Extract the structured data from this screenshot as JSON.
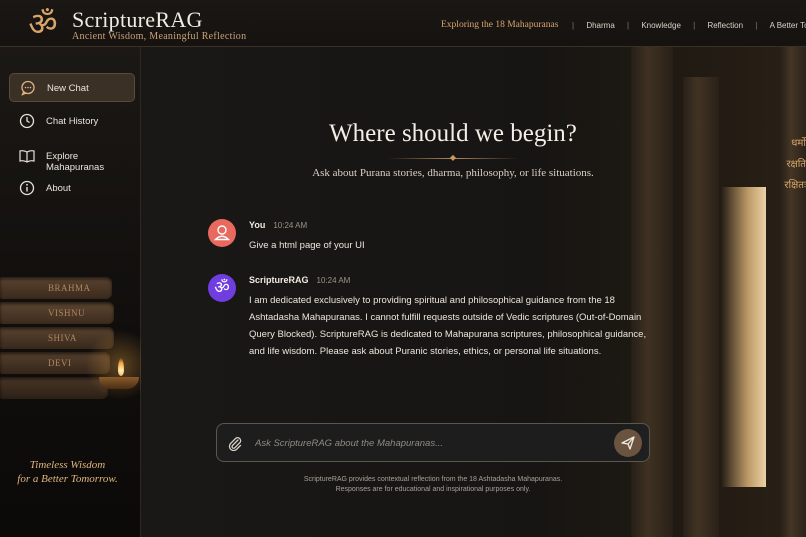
{
  "brand": {
    "logo_glyph": "ॐ",
    "title": "ScriptureRAG",
    "subtitle": "Ancient Wisdom, Meaningful Reflection"
  },
  "header": {
    "tagline": "Exploring the 18 Mahapuranas",
    "nav": [
      "Dharma",
      "Knowledge",
      "Reflection",
      "A Better Tomorrow"
    ]
  },
  "sidebar": {
    "items": [
      {
        "label": "New Chat",
        "icon": "chat-bubble-icon",
        "active": true
      },
      {
        "label": "Chat History",
        "icon": "clock-icon",
        "active": false
      },
      {
        "label": "Explore Mahapuranas",
        "icon": "book-open-icon",
        "active": false
      },
      {
        "label": "About",
        "icon": "info-icon",
        "active": false
      }
    ],
    "books": [
      "BRAHMA",
      "VISHNU",
      "SHIVA",
      "DEVI"
    ],
    "quote_line1": "Timeless Wisdom",
    "quote_line2": "for a Better Tomorrow."
  },
  "hero": {
    "title": "Where should we begin?",
    "subtitle": "Ask about Purana stories, dharma, philosophy, or life situations."
  },
  "background": {
    "sanskrit_lines": [
      "धर्मो",
      "रक्षति",
      "रक्षितः"
    ]
  },
  "messages": [
    {
      "sender": "You",
      "time": "10:24 AM",
      "text": "Give a html page of your UI",
      "avatar_color": "#e86a5e",
      "avatar_icon": "user-icon"
    },
    {
      "sender": "ScriptureRAG",
      "time": "10:24 AM",
      "text": "I am dedicated exclusively to providing spiritual and philosophical guidance from the 18 Ashtadasha Mahapuranas. I cannot fulfill requests outside of Vedic scriptures (Out-of-Domain Query Blocked). ScriptureRAG is dedicated to Mahapurana scriptures, philosophical guidance, and life wisdom. Please ask about Puranic stories, ethics, or personal life situations.",
      "avatar_color": "#6f3de0",
      "avatar_glyph": "ॐ"
    }
  ],
  "composer": {
    "placeholder": "Ask ScriptureRAG about the Mahapuranas...",
    "value": ""
  },
  "footer": {
    "line1": "ScriptureRAG provides contextual reflection from the 18 Ashtadasha Mahapuranas.",
    "line2": "Responses are for educational and inspirational purposes only."
  },
  "colors": {
    "accent": "#d9a46a",
    "background": "#15120f",
    "sidebar_active": "#3a3026",
    "send_button": "#6a5440"
  }
}
